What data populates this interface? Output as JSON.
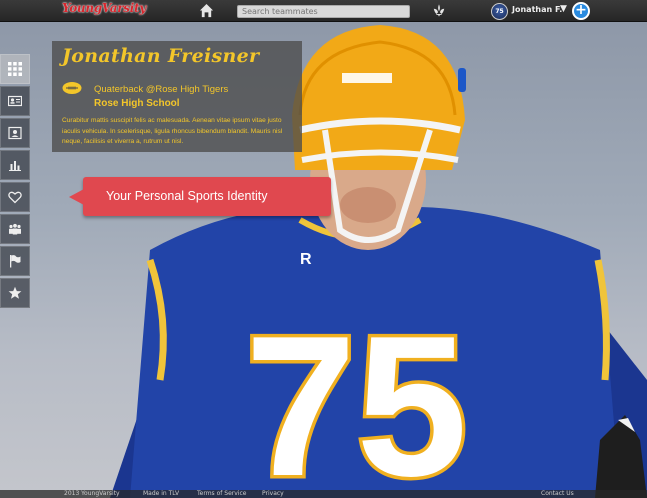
{
  "topbar": {
    "logo": "YoungVarsity",
    "search_placeholder": "Search teammates",
    "user_name": "Jonathan F.",
    "caret": "▼",
    "plus": "+",
    "avatar_text": "75"
  },
  "sidebar": {
    "items": [
      {
        "icon": "grid-icon"
      },
      {
        "icon": "id-card-icon"
      },
      {
        "icon": "contact-card-icon"
      },
      {
        "icon": "bar-chart-icon"
      },
      {
        "icon": "heart-icon"
      },
      {
        "icon": "team-icon"
      },
      {
        "icon": "flag-icon"
      },
      {
        "icon": "star-icon"
      }
    ]
  },
  "profile": {
    "name": "Jonathan Freisner",
    "position": "Quaterback @Rose High Tigers",
    "school": "Rose High School",
    "bio": "Curabitur mattis suscipit felis ac malesuada. Aenean vitae ipsum vitae justo iaculis vehicula. In scelerisque, ligula rhoncus bibendum blandit. Mauris nisl neque, facilisis et viverra a, rutrum ut nisl."
  },
  "callout": {
    "text": "Your Personal Sports Identity"
  },
  "hero": {
    "jersey_number": "75"
  },
  "footer": {
    "copyright": "2013 YoungVarsity",
    "made_in": "Made in TLV",
    "terms": "Terms of Service",
    "privacy": "Privacy",
    "contact": "Contact Us"
  },
  "colors": {
    "accent_yellow": "#f3c62a",
    "callout_red": "#e0484f",
    "brand_red": "#d8262d",
    "jersey_blue": "#1f3ea0"
  }
}
